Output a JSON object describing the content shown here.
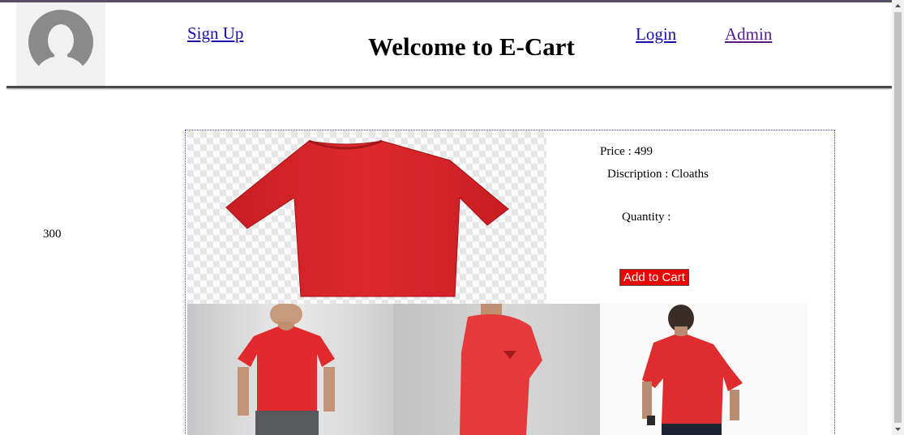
{
  "header": {
    "title": "Welcome to E-Cart",
    "nav": {
      "signup": "Sign Up",
      "login": "Login",
      "admin": "Admin"
    },
    "avatar_icon": "user-silhouette-icon"
  },
  "sidebar": {
    "value": "300"
  },
  "product": {
    "price": "Price : 499",
    "description": "Discription : Cloaths",
    "quantity_label": "Quantity :",
    "add_to_cart": "Add to Cart"
  },
  "colors": {
    "product_red": "#d9262b",
    "button_red": "#ee0000",
    "link_blue": "#1a0dab",
    "link_visited": "#551a8b"
  }
}
